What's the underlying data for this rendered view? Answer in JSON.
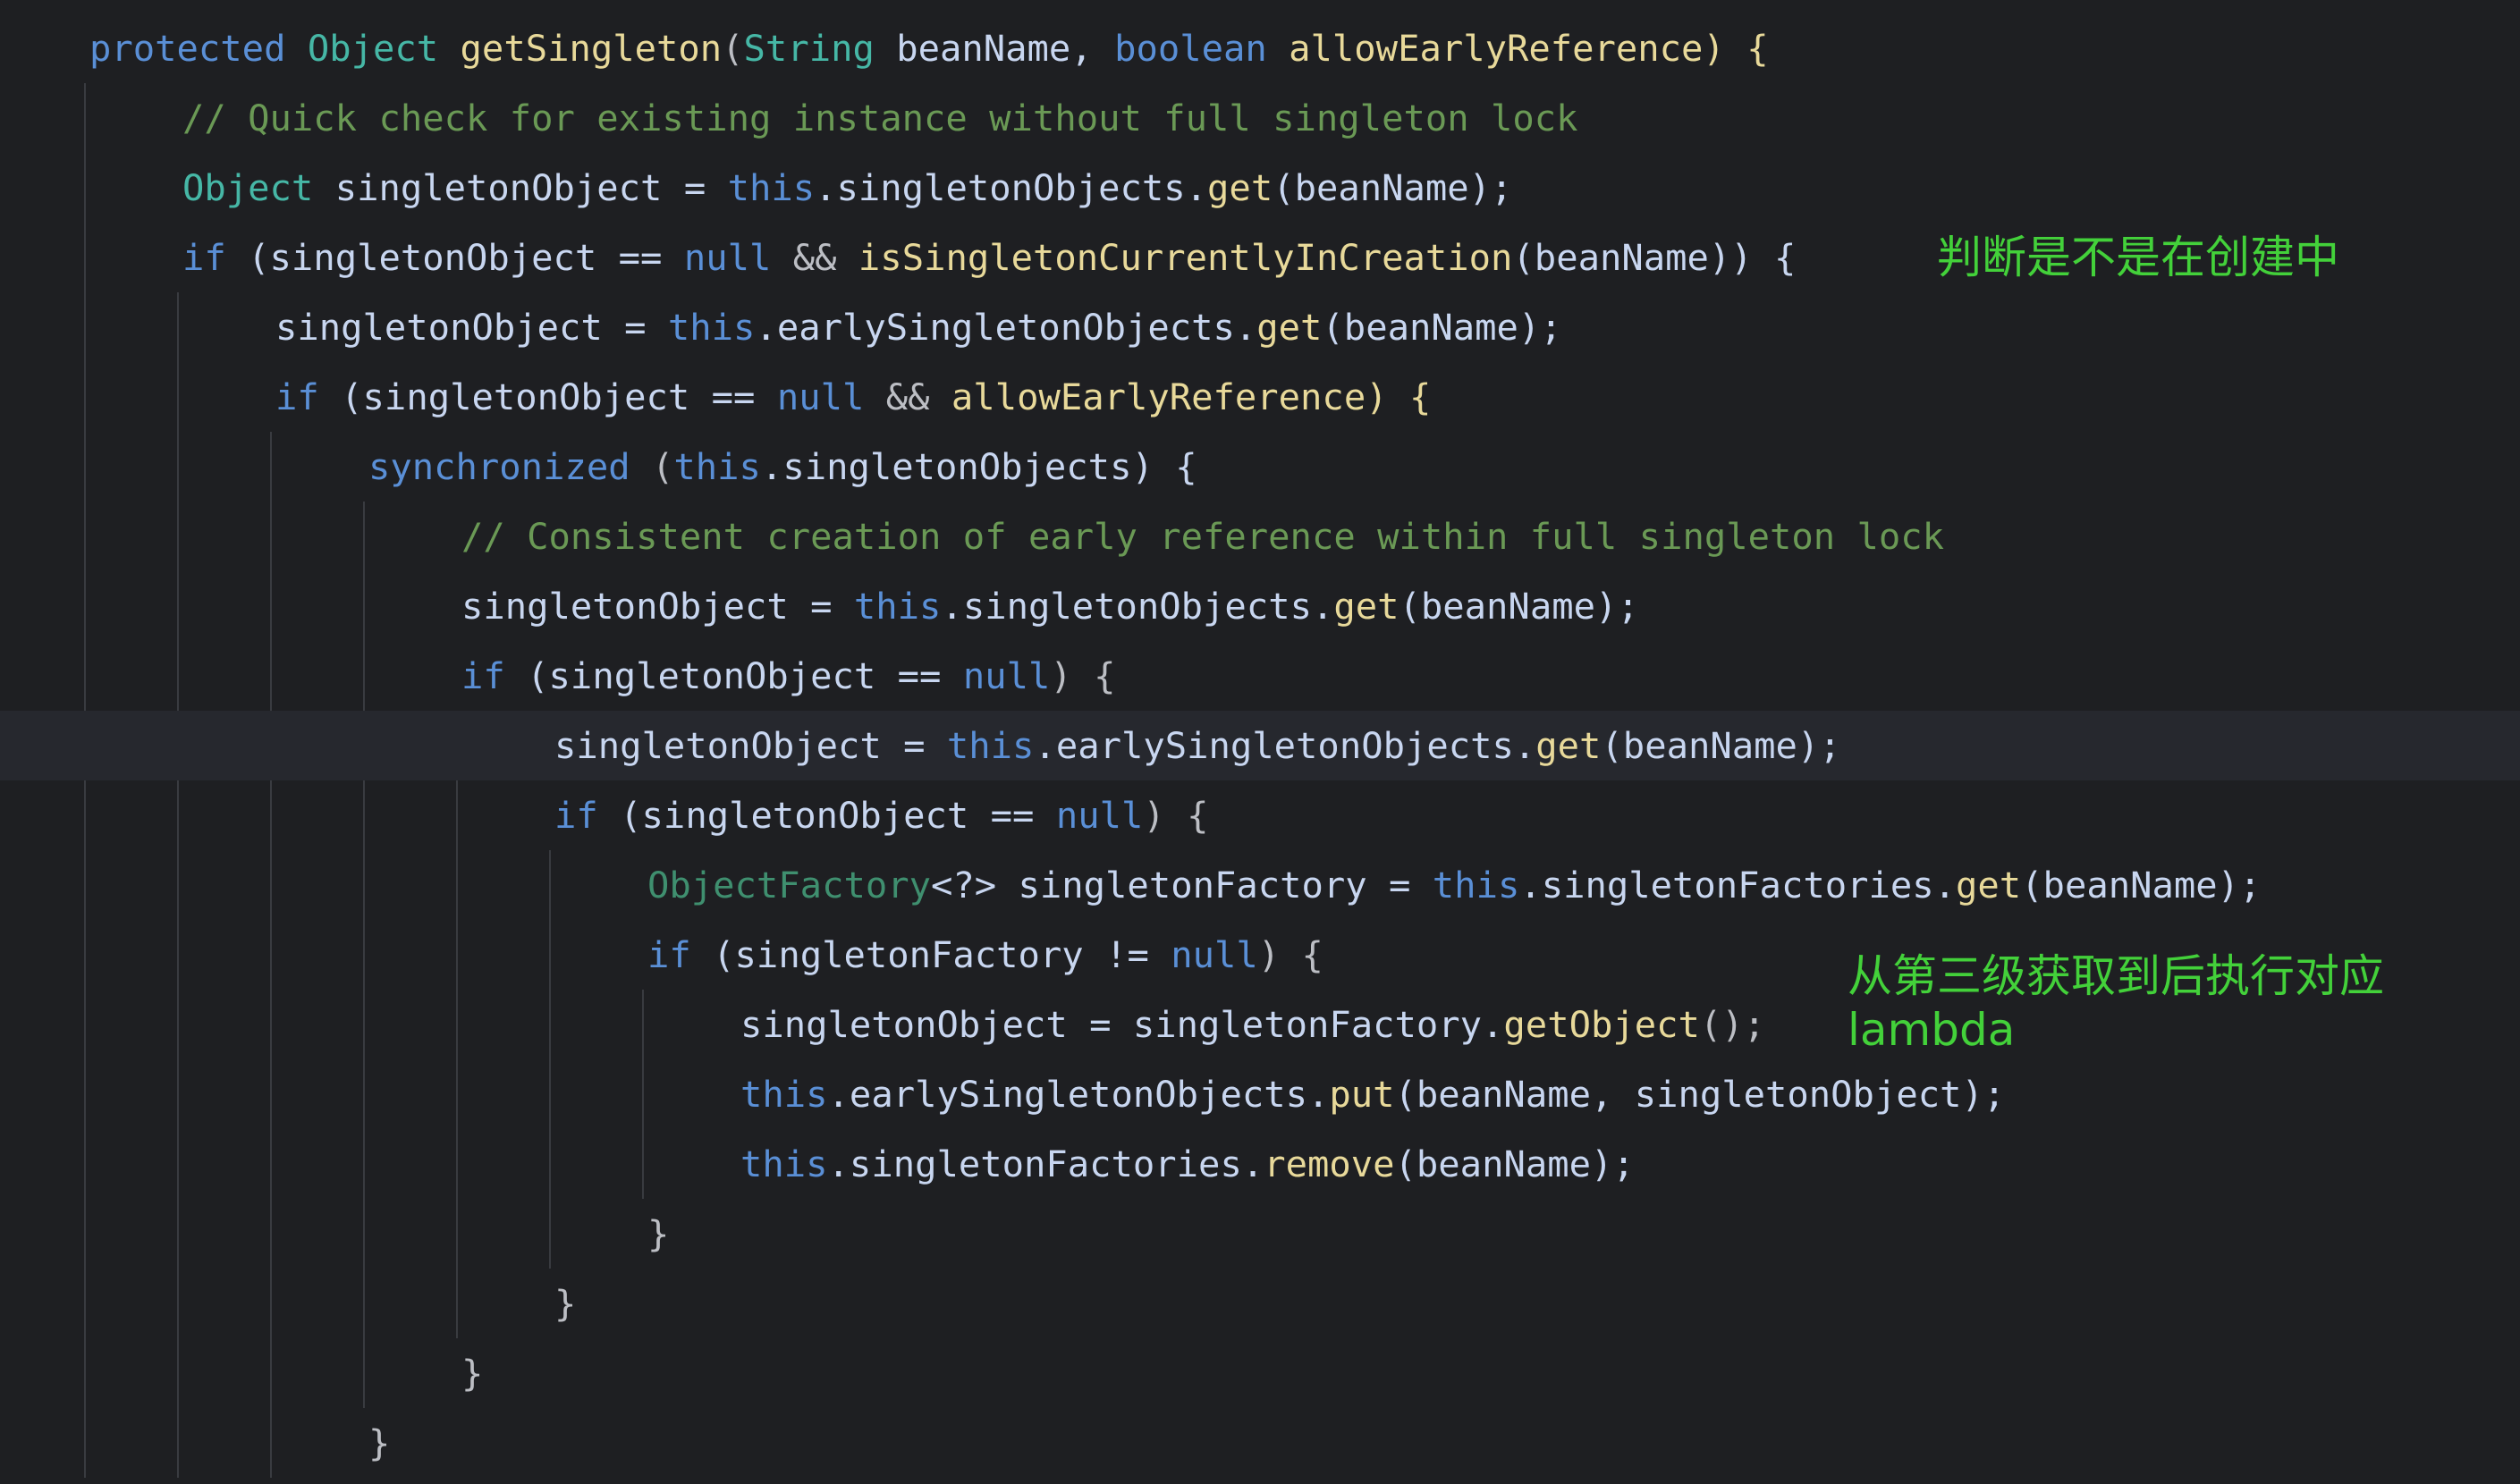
{
  "editor": {
    "background": "#1e1f22",
    "lines": [
      {
        "indent": 0,
        "tokens": [
          {
            "t": "protected",
            "c": "kw"
          },
          {
            "t": " ",
            "c": "plain"
          },
          {
            "t": "Object",
            "c": "cls"
          },
          {
            "t": " ",
            "c": "plain"
          },
          {
            "t": "getSingleton",
            "c": "mth"
          },
          {
            "t": "(",
            "c": "plain"
          },
          {
            "t": "String",
            "c": "cls"
          },
          {
            "t": " beanName, ",
            "c": "var"
          },
          {
            "t": "boolean",
            "c": "kw"
          },
          {
            "t": " allowEarlyReference) {",
            "c": "mth"
          }
        ]
      },
      {
        "indent": 1,
        "tokens": [
          {
            "t": "// Quick check for existing instance without full singleton lock",
            "c": "cmt"
          }
        ]
      },
      {
        "indent": 1,
        "tokens": [
          {
            "t": "Object",
            "c": "cls"
          },
          {
            "t": " singletonObject = ",
            "c": "var"
          },
          {
            "t": "this",
            "c": "kw"
          },
          {
            "t": ".singletonObjects.",
            "c": "fld"
          },
          {
            "t": "get",
            "c": "mth"
          },
          {
            "t": "(beanName);",
            "c": "var"
          }
        ]
      },
      {
        "indent": 1,
        "tokens": [
          {
            "t": "if",
            "c": "kw"
          },
          {
            "t": " (singletonObject == ",
            "c": "var"
          },
          {
            "t": "null",
            "c": "kw"
          },
          {
            "t": " && ",
            "c": "op"
          },
          {
            "t": "isSingletonCurrentlyInCreation",
            "c": "mth"
          },
          {
            "t": "(beanName)) {",
            "c": "var"
          }
        ]
      },
      {
        "indent": 2,
        "tokens": [
          {
            "t": "singletonObject = ",
            "c": "var"
          },
          {
            "t": "this",
            "c": "kw"
          },
          {
            "t": ".earlySingletonObjects.",
            "c": "fld"
          },
          {
            "t": "get",
            "c": "mth"
          },
          {
            "t": "(beanName);",
            "c": "var"
          }
        ]
      },
      {
        "indent": 2,
        "tokens": [
          {
            "t": "if",
            "c": "kw"
          },
          {
            "t": " (singletonObject == ",
            "c": "var"
          },
          {
            "t": "null",
            "c": "kw"
          },
          {
            "t": " && ",
            "c": "op"
          },
          {
            "t": "allowEarlyReference) {",
            "c": "mth"
          }
        ]
      },
      {
        "indent": 3,
        "tokens": [
          {
            "t": "synchronized",
            "c": "kw"
          },
          {
            "t": " (",
            "c": "plain"
          },
          {
            "t": "this",
            "c": "kw"
          },
          {
            "t": ".singletonObjects) {",
            "c": "fld"
          }
        ]
      },
      {
        "indent": 4,
        "tokens": [
          {
            "t": "// Consistent creation of early reference within full singleton lock",
            "c": "cmt"
          }
        ]
      },
      {
        "indent": 4,
        "tokens": [
          {
            "t": "singletonObject = ",
            "c": "var"
          },
          {
            "t": "this",
            "c": "kw"
          },
          {
            "t": ".singletonObjects.",
            "c": "fld"
          },
          {
            "t": "get",
            "c": "mth"
          },
          {
            "t": "(beanName);",
            "c": "var"
          }
        ]
      },
      {
        "indent": 4,
        "tokens": [
          {
            "t": "if",
            "c": "kw"
          },
          {
            "t": " (singletonObject == ",
            "c": "var"
          },
          {
            "t": "null",
            "c": "kw"
          },
          {
            "t": ") {",
            "c": "plain"
          }
        ]
      },
      {
        "indent": 5,
        "current": true,
        "tokens": [
          {
            "t": "singletonObject = ",
            "c": "var"
          },
          {
            "t": "this",
            "c": "kw"
          },
          {
            "t": ".earlySingletonObjects.",
            "c": "fld"
          },
          {
            "t": "get",
            "c": "mth"
          },
          {
            "t": "(beanName);",
            "c": "var"
          }
        ]
      },
      {
        "indent": 5,
        "tokens": [
          {
            "t": "if",
            "c": "kw"
          },
          {
            "t": " (singletonObject == ",
            "c": "var"
          },
          {
            "t": "null",
            "c": "kw"
          },
          {
            "t": ") {",
            "c": "plain"
          }
        ]
      },
      {
        "indent": 6,
        "tokens": [
          {
            "t": "ObjectFactory",
            "c": "gen"
          },
          {
            "t": "<?> singletonFactory = ",
            "c": "var"
          },
          {
            "t": "this",
            "c": "kw"
          },
          {
            "t": ".singletonFactories.",
            "c": "fld"
          },
          {
            "t": "get",
            "c": "mth"
          },
          {
            "t": "(beanName);",
            "c": "var"
          }
        ]
      },
      {
        "indent": 6,
        "tokens": [
          {
            "t": "if",
            "c": "kw"
          },
          {
            "t": " (singletonFactory != ",
            "c": "var"
          },
          {
            "t": "null",
            "c": "kw"
          },
          {
            "t": ") {",
            "c": "plain"
          }
        ]
      },
      {
        "indent": 7,
        "tokens": [
          {
            "t": "singletonObject = singletonFactory.",
            "c": "var"
          },
          {
            "t": "getObject",
            "c": "mth"
          },
          {
            "t": "();",
            "c": "plain"
          }
        ]
      },
      {
        "indent": 7,
        "tokens": [
          {
            "t": "this",
            "c": "kw"
          },
          {
            "t": ".earlySingletonObjects.",
            "c": "fld"
          },
          {
            "t": "put",
            "c": "mth"
          },
          {
            "t": "(beanName, singletonObject);",
            "c": "var"
          }
        ]
      },
      {
        "indent": 7,
        "tokens": [
          {
            "t": "this",
            "c": "kw"
          },
          {
            "t": ".singletonFactories.",
            "c": "fld"
          },
          {
            "t": "remove",
            "c": "mth"
          },
          {
            "t": "(beanName);",
            "c": "var"
          }
        ]
      },
      {
        "indent": 6,
        "tokens": [
          {
            "t": "}",
            "c": "plain"
          }
        ]
      },
      {
        "indent": 5,
        "tokens": [
          {
            "t": "}",
            "c": "plain"
          }
        ]
      },
      {
        "indent": 4,
        "tokens": [
          {
            "t": "}",
            "c": "plain"
          }
        ]
      },
      {
        "indent": 3,
        "tokens": [
          {
            "t": "}",
            "c": "plain"
          }
        ]
      }
    ]
  },
  "annotations": {
    "creation_check": "判断是不是在创建中",
    "third_level": "从第三级获取到后执行对应\nlambda"
  },
  "colors": {
    "keyword": "#5a8fd6",
    "class": "#46b7a6",
    "method": "#e8d99a",
    "field": "#c8d6f0",
    "comment": "#6a9955",
    "annotation": "#43d13a"
  }
}
